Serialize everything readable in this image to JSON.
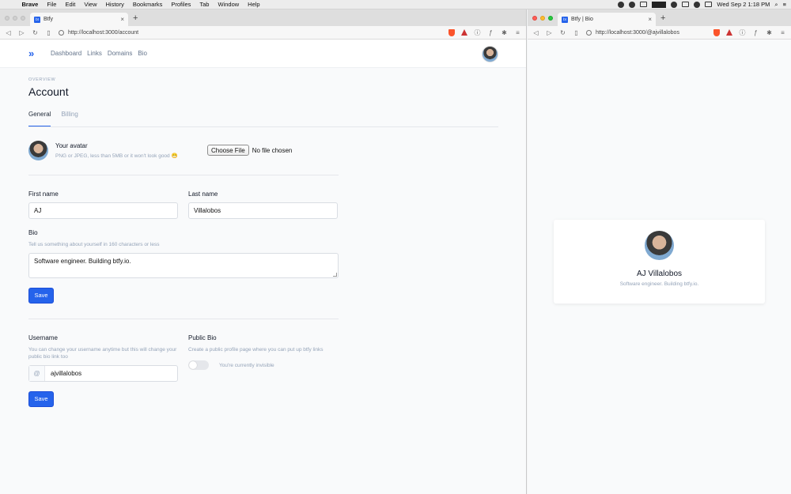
{
  "menubar": {
    "app": "Brave",
    "items": [
      "File",
      "Edit",
      "View",
      "History",
      "Bookmarks",
      "Profiles",
      "Tab",
      "Window",
      "Help"
    ],
    "clock": "Wed Sep 2  1:18 PM"
  },
  "left_browser": {
    "tab_title": "Btfy",
    "url": "http://localhost:3000/account"
  },
  "app": {
    "nav": [
      "Dashboard",
      "Links",
      "Domains",
      "Bio"
    ],
    "overline": "OVERVIEW",
    "title": "Account",
    "tabs": [
      "General",
      "Billing"
    ],
    "avatar_label": "Your avatar",
    "avatar_hint": "PNG or JPEG, less than 5MB or it won't look good 😁",
    "file_button": "Choose File",
    "file_status": "No file chosen",
    "first_name_label": "First name",
    "first_name_value": "AJ",
    "last_name_label": "Last name",
    "last_name_value": "Villalobos",
    "bio_label": "Bio",
    "bio_hint": "Tell us something about yourself in 160 characters or less",
    "bio_value": "Software engineer. Building btfy.io.",
    "save_label": "Save",
    "username_label": "Username",
    "username_hint": "You can change your username anytime but this will change your public bio link too",
    "username_prefix": "@",
    "username_value": "ajvillalobos",
    "public_bio_label": "Public Bio",
    "public_bio_hint": "Create a public profile page where you can put up btfy links",
    "toggle_status": "You're currently invisible",
    "save2_label": "Save"
  },
  "right_browser": {
    "tab_title": "Btfy | Bio",
    "url": "http://localhost:3000/@ajvillalobos",
    "name": "AJ Villalobos",
    "bio": "Software engineer. Building btfy.io."
  },
  "colors": {
    "accent": "#2563eb",
    "muted": "#94a3b8"
  },
  "public_bio_enabled": false
}
